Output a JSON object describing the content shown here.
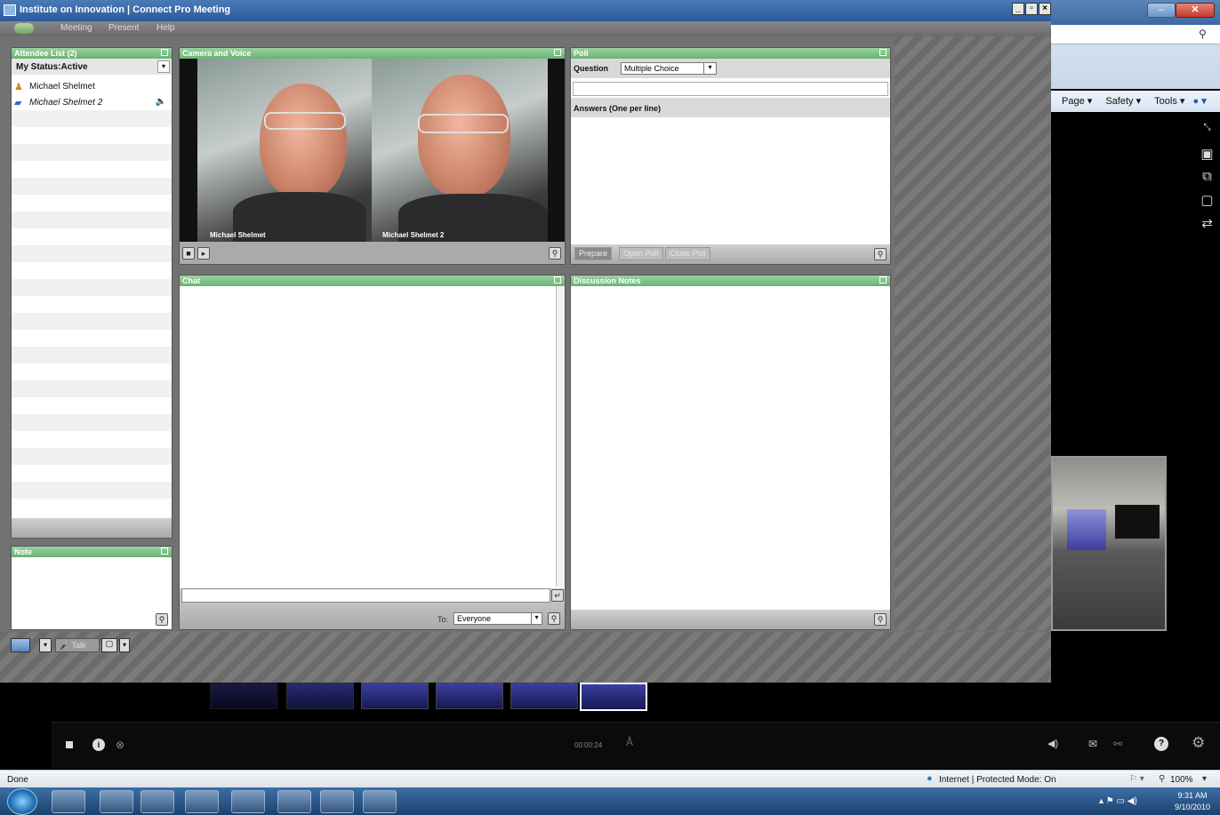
{
  "window": {
    "title": "Institute on Innovation | Connect Pro Meeting",
    "menu": [
      "Meeting",
      "Present",
      "Help"
    ]
  },
  "attendees": {
    "header": "Attendee List (2)",
    "status": "My Status:Active",
    "people": [
      {
        "name": "Michael Shelmet",
        "role": "host"
      },
      {
        "name": "Michael Shelmet 2",
        "role": "presenter"
      }
    ]
  },
  "note": {
    "header": "Note"
  },
  "camera": {
    "header": "Camera and Voice",
    "feeds": [
      "Michael Shelmet",
      "Michael Shelmet 2"
    ]
  },
  "poll": {
    "header": "Poll",
    "question_label": "Question",
    "question_type": "Multiple Choice",
    "answers_label": "Answers (One per line)",
    "buttons": [
      "Prepare",
      "Open Poll",
      "Close Poll"
    ]
  },
  "chat": {
    "header": "Chat",
    "to_label": "To:",
    "to_value": "Everyone"
  },
  "notes": {
    "header": "Discussion Notes"
  },
  "bottom_toolbar": {
    "talk": "Talk"
  },
  "ie": {
    "commands": [
      "Page",
      "Safety",
      "Tools"
    ]
  },
  "player": {
    "time": "00:00:24"
  },
  "statusbar": {
    "left": "Done",
    "zone": "Internet | Protected Mode: On",
    "zoom": "100%"
  },
  "clock": {
    "time": "9:31 AM",
    "date": "9/10/2010"
  }
}
